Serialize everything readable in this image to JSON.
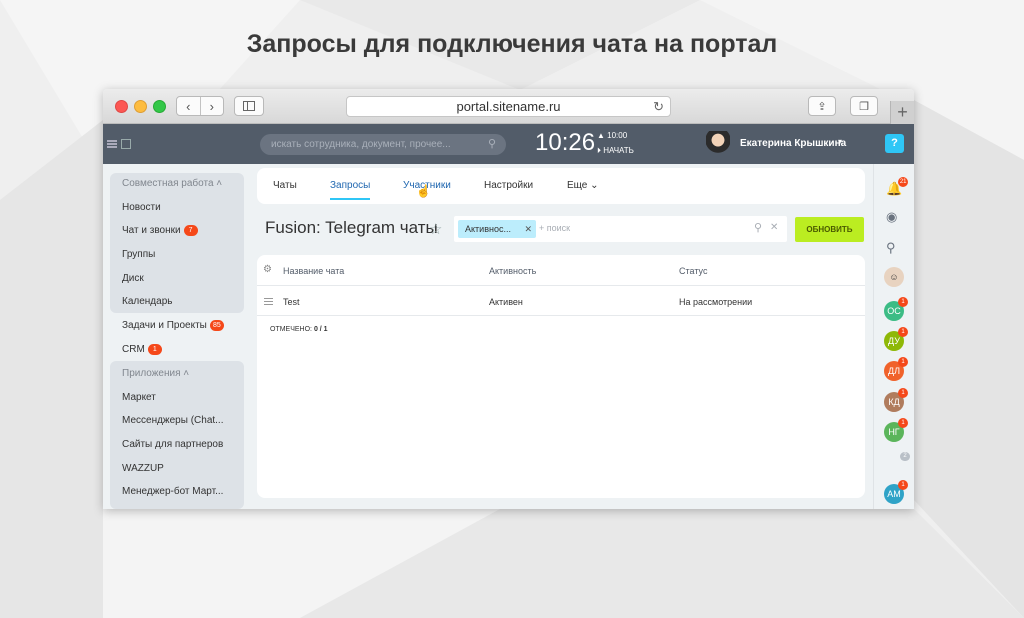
{
  "page_title": "Запросы для подключения чата на портал",
  "browser": {
    "url": "portal.sitename.ru",
    "back_glyph": "‹",
    "forward_glyph": "›",
    "plus_glyph": "+"
  },
  "header": {
    "search_placeholder": "искать сотрудника, документ, прочее...",
    "time": "10:26",
    "alarm_time": "10:00",
    "start_label": "НАЧАТЬ",
    "user_name": "Екатерина Крышкина",
    "help_label": "?"
  },
  "left_menu": {
    "groups": [
      {
        "title": "Совместная работа",
        "items": [
          {
            "label": "Новости"
          },
          {
            "label": "Чат и звонки",
            "badge": "7"
          },
          {
            "label": "Группы"
          },
          {
            "label": "Диск"
          },
          {
            "label": "Календарь"
          }
        ]
      },
      {
        "items": [
          {
            "label": "Задачи и Проекты",
            "badge": "85"
          },
          {
            "label": "CRM",
            "badge": "1"
          }
        ]
      },
      {
        "title": "Приложения",
        "items": [
          {
            "label": "Маркет"
          },
          {
            "label": "Мессенджеры (Chat..."
          },
          {
            "label": "Сайты для партнеров"
          },
          {
            "label": "WAZZUP"
          },
          {
            "label": "Менеджер-бот Март..."
          }
        ]
      }
    ]
  },
  "tabs": [
    {
      "label": "Чаты"
    },
    {
      "label": "Запросы",
      "active": true
    },
    {
      "label": "Участники"
    },
    {
      "label": "Настройки"
    },
    {
      "label": "Еще"
    }
  ],
  "list": {
    "title": "Fusion: Telegram чаты",
    "filter_chip": "Активнос...",
    "filter_add": "+ поиск",
    "refresh_button": "ОБНОВИТЬ"
  },
  "grid": {
    "columns": [
      "Название чата",
      "Активность",
      "Статус"
    ],
    "rows": [
      {
        "name": "Test",
        "activity": "Активен",
        "status": "На рассмотрении"
      }
    ],
    "selected_label": "ОТМЕЧЕНО:",
    "selected_value": "0 / 1"
  },
  "right_panel": {
    "notifications_badge": "21",
    "avatars": [
      {
        "initials": "ОС",
        "color": "#3cbc85",
        "badge": "1"
      },
      {
        "initials": "ДУ",
        "color": "#8eb807",
        "badge": "1"
      },
      {
        "initials": "ДЛ",
        "color": "#f0622b",
        "badge": "1"
      },
      {
        "initials": "КД",
        "color": "#b07c5d",
        "badge": "1"
      },
      {
        "initials": "НГ",
        "color": "#5bb55b",
        "badge": "1"
      },
      {
        "initials": "АМ",
        "color": "#2fa3c7",
        "badge": "1"
      }
    ],
    "more_count": "2"
  },
  "colors": {
    "header_bg": "#525c69",
    "accent_blue": "#2fc6f6",
    "refresh_green": "#bbed21",
    "badge_red": "#f54819"
  }
}
